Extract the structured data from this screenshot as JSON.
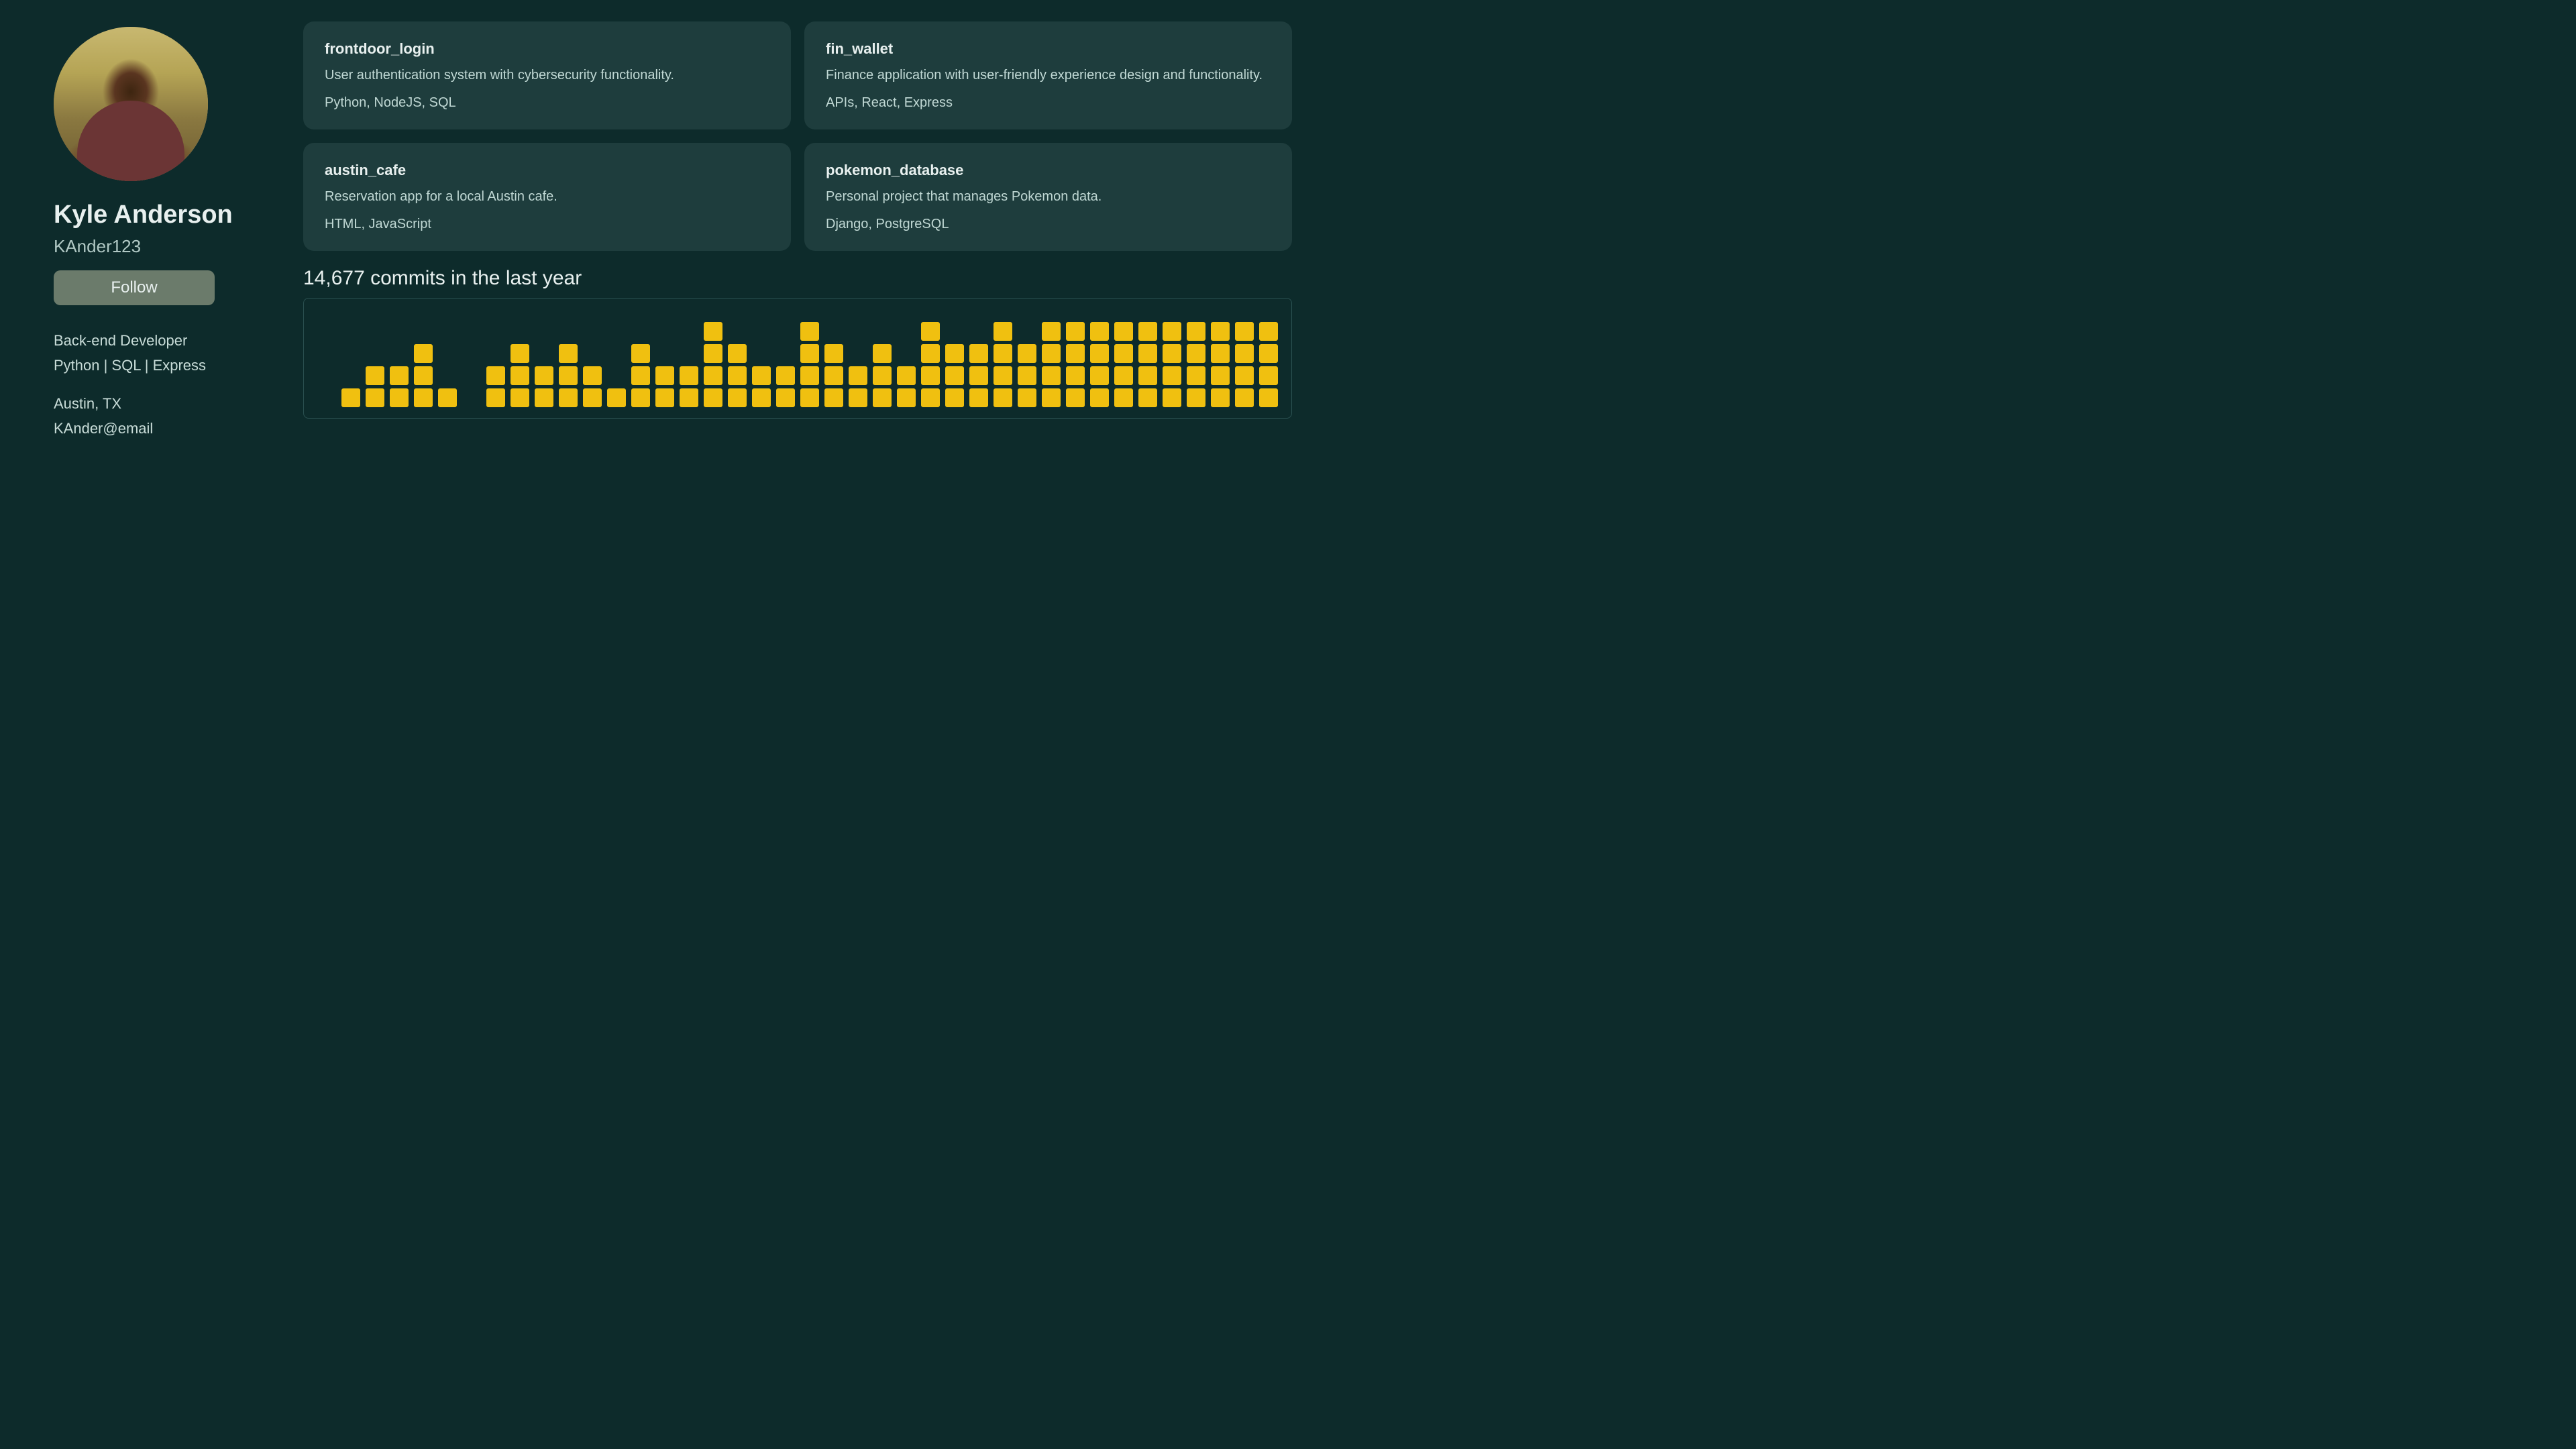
{
  "profile": {
    "name": "Kyle Anderson",
    "username": "KAnder123",
    "follow_label": "Follow",
    "role": "Back-end Developer",
    "skills": "Python | SQL | Express",
    "location": "Austin, TX",
    "email": "KAnder@email"
  },
  "repos": [
    {
      "name": "frontdoor_login",
      "desc": "User authentication system with cybersecurity  functionality.",
      "tech": "Python, NodeJS, SQL"
    },
    {
      "name": "fin_wallet",
      "desc": "Finance application with user-friendly experience design and functionality.",
      "tech": "APIs, React, Express"
    },
    {
      "name": "austin_cafe",
      "desc": "Reservation app for a local Austin cafe.",
      "tech": "HTML, JavaScript"
    },
    {
      "name": "pokemon_database",
      "desc": "Personal project that manages Pokemon data.",
      "tech": "Django, PostgreSQL"
    }
  ],
  "commits": {
    "label": "14,677 commits in the last year",
    "columns": [
      0,
      1,
      2,
      2,
      3,
      1,
      0,
      2,
      3,
      2,
      3,
      2,
      1,
      3,
      2,
      2,
      4,
      3,
      2,
      2,
      4,
      3,
      2,
      3,
      2,
      4,
      3,
      3,
      4,
      3,
      4,
      4,
      4,
      4,
      4,
      4,
      4,
      4,
      4,
      4
    ]
  },
  "colors": {
    "background": "#0d2b2b",
    "card_bg": "#1e3d3d",
    "commit_yellow": "#f0c010",
    "follow_btn": "#6b7b6b"
  }
}
